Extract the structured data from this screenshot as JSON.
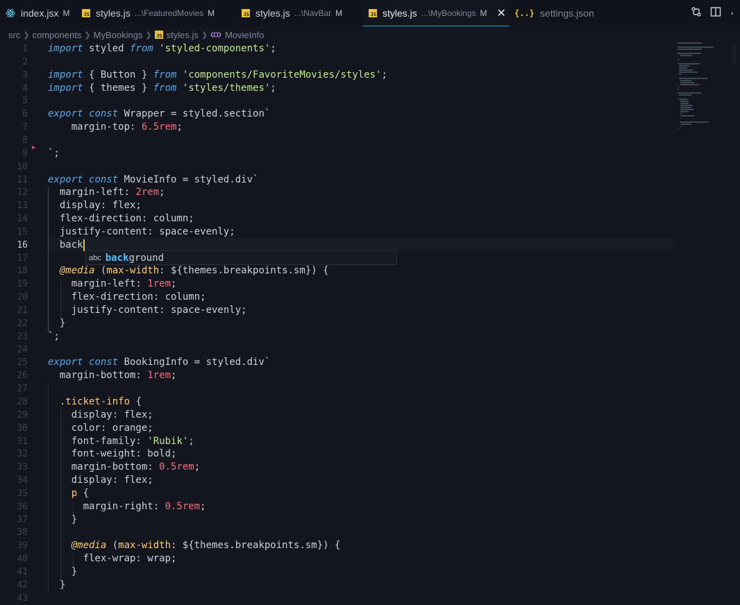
{
  "tabs": [
    {
      "name": "index.jsx",
      "desc": "",
      "mod": "M",
      "icon": "react-icon",
      "active": false
    },
    {
      "name": "styles.js",
      "desc": "...\\FeaturedMovies",
      "mod": "M",
      "icon": "js-file-icon",
      "active": false
    },
    {
      "name": "styles.js",
      "desc": "...\\NavBar",
      "mod": "M",
      "icon": "js-file-icon",
      "active": false
    },
    {
      "name": "styles.js",
      "desc": "...\\MyBookings",
      "mod": "M",
      "icon": "js-file-icon",
      "active": true
    },
    {
      "name": "settings.json",
      "desc": "",
      "mod": "",
      "icon": "json-file-icon",
      "active": false
    }
  ],
  "breadcrumb": {
    "src": "src",
    "components": "components",
    "folder": "MyBookings",
    "file": "styles.js",
    "symbol": "MovieInfo"
  },
  "js_badge": "JS",
  "json_badge": "{..}",
  "close_glyph": "✕",
  "more_glyph": "·",
  "suggestion": {
    "kind": "abc",
    "match": "back",
    "rest": "ground"
  },
  "colors": {
    "accent": "#2fa3c9",
    "caret": "#e5c13a",
    "keyword": "#5aa9e6",
    "string": "#c3e88d",
    "number": "#f07178",
    "selector": "#ffcb6b"
  },
  "current_line": 16,
  "lines": [
    [
      [
        "kw",
        "import"
      ],
      [
        "p",
        " styled "
      ],
      [
        "fr",
        "from"
      ],
      [
        "p",
        " "
      ],
      [
        "str",
        "'styled-components'"
      ],
      [
        "p",
        ";"
      ]
    ],
    [],
    [
      [
        "kw",
        "import"
      ],
      [
        "p",
        " { Button } "
      ],
      [
        "fr",
        "from"
      ],
      [
        "p",
        " "
      ],
      [
        "str",
        "'components/FavoriteMovies/styles'"
      ],
      [
        "p",
        ";"
      ]
    ],
    [
      [
        "kw",
        "import"
      ],
      [
        "p",
        " { themes } "
      ],
      [
        "fr",
        "from"
      ],
      [
        "p",
        " "
      ],
      [
        "str",
        "'styles/themes'"
      ],
      [
        "p",
        ";"
      ]
    ],
    [],
    [
      [
        "kw",
        "export"
      ],
      [
        "p",
        " "
      ],
      [
        "kw",
        "const"
      ],
      [
        "p",
        " Wrapper = styled.section`"
      ]
    ],
    [
      [
        "p",
        "    margin-top: "
      ],
      [
        "num",
        "6.5rem"
      ],
      [
        "p",
        ";"
      ]
    ],
    [],
    [
      [
        "p",
        "`;"
      ]
    ],
    [],
    [
      [
        "kw",
        "export"
      ],
      [
        "p",
        " "
      ],
      [
        "kw",
        "const"
      ],
      [
        "p",
        " MovieInfo = styled.div`"
      ]
    ],
    [
      [
        "p",
        "  margin-left: "
      ],
      [
        "num",
        "2rem"
      ],
      [
        "p",
        ";"
      ]
    ],
    [
      [
        "p",
        "  display: flex;"
      ]
    ],
    [
      [
        "p",
        "  flex-direction: column;"
      ]
    ],
    [
      [
        "p",
        "  justify-content: space-evenly;"
      ]
    ],
    [
      [
        "p",
        "  back"
      ],
      [
        "caret",
        ""
      ]
    ],
    [],
    [
      [
        "p",
        "  "
      ],
      [
        "at",
        "@media"
      ],
      [
        "p",
        " ("
      ],
      [
        "sel",
        "max-width"
      ],
      [
        "p",
        ": ${themes.breakpoints.sm}) {"
      ]
    ],
    [
      [
        "p",
        "    margin-left: "
      ],
      [
        "num",
        "1rem"
      ],
      [
        "p",
        ";"
      ]
    ],
    [
      [
        "p",
        "    flex-direction: column;"
      ]
    ],
    [
      [
        "p",
        "    justify-content: space-evenly;"
      ]
    ],
    [
      [
        "p",
        "  }"
      ]
    ],
    [
      [
        "p",
        "`;"
      ]
    ],
    [],
    [
      [
        "kw",
        "export"
      ],
      [
        "p",
        " "
      ],
      [
        "kw",
        "const"
      ],
      [
        "p",
        " BookingInfo = styled.div`"
      ]
    ],
    [
      [
        "p",
        "  margin-bottom: "
      ],
      [
        "num",
        "1rem"
      ],
      [
        "p",
        ";"
      ]
    ],
    [],
    [
      [
        "p",
        "  "
      ],
      [
        "sel",
        ".ticket-info"
      ],
      [
        "p",
        " {"
      ]
    ],
    [
      [
        "p",
        "    display: flex;"
      ]
    ],
    [
      [
        "p",
        "    color: orange;"
      ]
    ],
    [
      [
        "p",
        "    font-family: "
      ],
      [
        "str",
        "'Rubik'"
      ],
      [
        "p",
        ";"
      ]
    ],
    [
      [
        "p",
        "    font-weight: bold;"
      ]
    ],
    [
      [
        "p",
        "    margin-bottom: "
      ],
      [
        "num",
        "0.5rem"
      ],
      [
        "p",
        ";"
      ]
    ],
    [
      [
        "p",
        "    display: flex;"
      ]
    ],
    [
      [
        "p",
        "    "
      ],
      [
        "sel",
        "p"
      ],
      [
        "p",
        " {"
      ]
    ],
    [
      [
        "p",
        "      margin-right: "
      ],
      [
        "num",
        "0.5rem"
      ],
      [
        "p",
        ";"
      ]
    ],
    [
      [
        "p",
        "    }"
      ]
    ],
    [],
    [
      [
        "p",
        "    "
      ],
      [
        "at",
        "@media"
      ],
      [
        "p",
        " ("
      ],
      [
        "sel",
        "max-width"
      ],
      [
        "p",
        ": ${themes.breakpoints.sm}) {"
      ]
    ],
    [
      [
        "p",
        "      flex-wrap: wrap;"
      ]
    ],
    [
      [
        "p",
        "    }"
      ]
    ],
    [
      [
        "p",
        "  }"
      ]
    ],
    []
  ]
}
